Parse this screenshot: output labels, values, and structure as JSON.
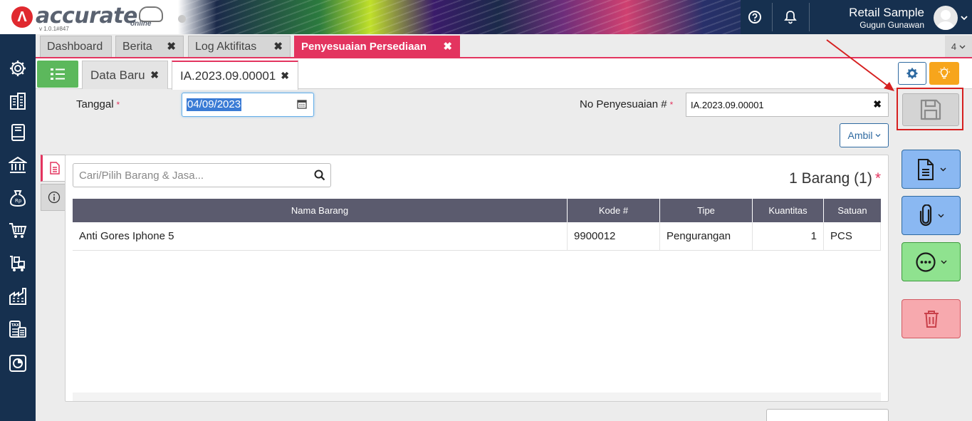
{
  "header": {
    "logo_text": "accurate",
    "logo_sub": "online",
    "version": "v 1.0.1#847",
    "company": "Retail Sample",
    "user": "Gugun Gunawan",
    "help_icon": "question-circle-icon",
    "notif_icon": "bell-icon"
  },
  "module_tabs": [
    {
      "label": "Dashboard"
    },
    {
      "label": "Berita"
    },
    {
      "label": "Log Aktifitas"
    },
    {
      "label": "Penyesuaian Persediaan"
    }
  ],
  "tab_count": "4",
  "sub_tabs": [
    {
      "label": "Data Baru"
    },
    {
      "label": "IA.2023.09.00001"
    }
  ],
  "nav_icons": [
    "gear-icon",
    "building-icon",
    "book-icon",
    "bank-icon",
    "money-bag-icon",
    "cart-icon",
    "warehouse-cart-icon",
    "factory-icon",
    "tax-calculator-icon",
    "report-chart-icon"
  ],
  "form": {
    "tanggal_label": "Tanggal",
    "tanggal_value": "04/09/2023",
    "no_label": "No Penyesuaian #",
    "no_value": "IA.2023.09.00001",
    "required_mark": "*",
    "ambil_label": "Ambil"
  },
  "detail": {
    "search_placeholder": "Cari/Pilih Barang & Jasa...",
    "count_text": "1 Barang (1)",
    "count_star": "*",
    "columns": [
      "Nama Barang",
      "Kode #",
      "Tipe",
      "Kuantitas",
      "Satuan"
    ],
    "rows": [
      {
        "nama": "Anti Gores Iphone 5",
        "kode": "9900012",
        "tipe": "Pengurangan",
        "qty": "1",
        "satuan": "PCS"
      }
    ]
  },
  "actions": [
    "save-icon",
    "document-icon",
    "paperclip-icon",
    "more-icon",
    "trash-icon"
  ],
  "colors": {
    "brand_pink": "#e3345f",
    "nav_dark": "#16304f",
    "list_green": "#5cb85c",
    "action_blue": "#8ab8f2",
    "action_green": "#8fe28f",
    "action_red": "#f7a9ae",
    "highlight_red": "#d62020"
  }
}
